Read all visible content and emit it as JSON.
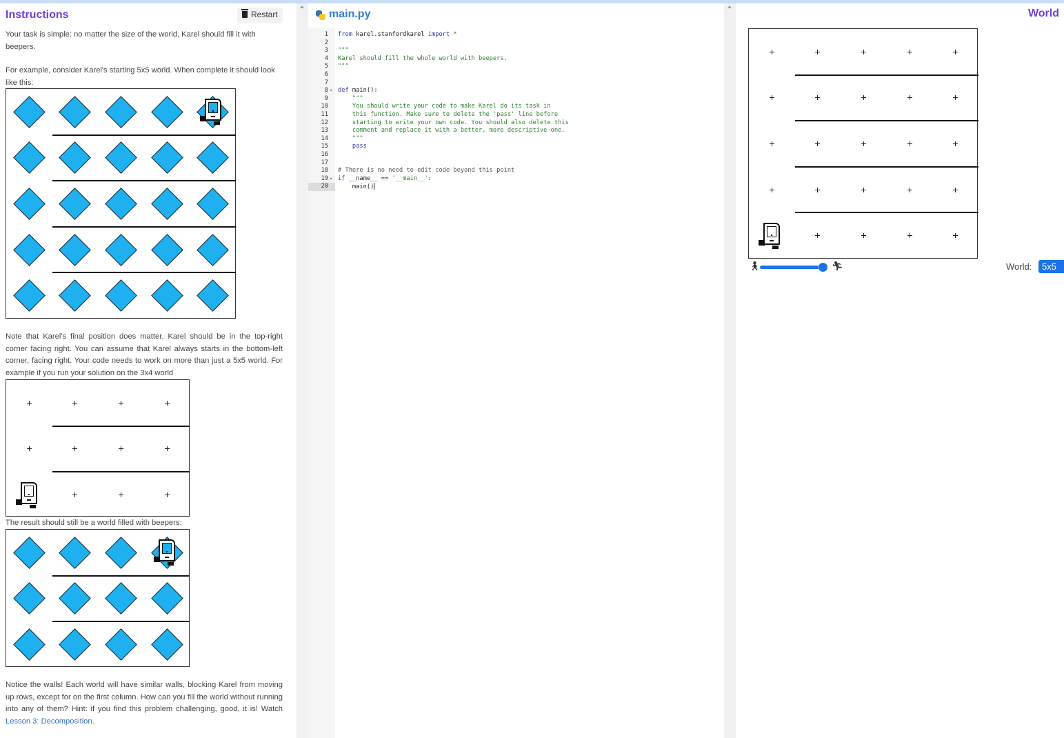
{
  "instructions": {
    "title": "Instructions",
    "restart_label": "Restart",
    "p1": "Your task is simple: no matter the size of the world, Karel should fill it with beepers.",
    "p2": "For example, consider Karel's starting 5x5 world. When complete it should look like this:",
    "p3": "Note that Karel's final position does matter. Karel should be in the top-right corner facing right. You can assume that Karel always starts in the bottom-left corner, facing right. Your code needs to work on more than just a 5x5 world. For example if you run your solution on the 3x4 world",
    "p4": "The result should still be a world filled with beepers:",
    "p5_text": "Notice the walls! Each world will have similar walls, blocking Karel from moving up rows, except for on the first column. How can you fill the world without running into any of them? Hint: if you find this problem challenging, good, it is! Watch ",
    "p5_link": "Lesson 3: Decomposition",
    "p5_end": "."
  },
  "editor": {
    "filename": "main.py",
    "lines": [
      {
        "n": "1",
        "fold": "",
        "html": "<span class=\"kw\">from</span> karel.stanfordkarel <span class=\"kw\">import</span> <span class=\"st\">*</span>"
      },
      {
        "n": "2",
        "fold": "",
        "html": ""
      },
      {
        "n": "3",
        "fold": "",
        "html": "<span class=\"st\">\"\"\"</span>"
      },
      {
        "n": "4",
        "fold": "",
        "html": "<span class=\"st\">Karel should fill the whole world with beepers.</span>"
      },
      {
        "n": "5",
        "fold": "",
        "html": "<span class=\"st\">\"\"\"</span>"
      },
      {
        "n": "6",
        "fold": "",
        "html": ""
      },
      {
        "n": "7",
        "fold": "",
        "html": ""
      },
      {
        "n": "8",
        "fold": "▾",
        "html": "<span class=\"kw\">def</span> main():"
      },
      {
        "n": "9",
        "fold": "",
        "html": "    <span class=\"st\">\"\"\"</span>"
      },
      {
        "n": "10",
        "fold": "",
        "html": "    <span class=\"st\">You should write your code to make Karel do its task in</span>"
      },
      {
        "n": "11",
        "fold": "",
        "html": "    <span class=\"st\">this function. Make sure to delete the 'pass' line before</span>"
      },
      {
        "n": "12",
        "fold": "",
        "html": "    <span class=\"st\">starting to write your own code. You should also delete this</span>"
      },
      {
        "n": "13",
        "fold": "",
        "html": "    <span class=\"st\">comment and replace it with a better, more descriptive one.</span>"
      },
      {
        "n": "14",
        "fold": "",
        "html": "    <span class=\"st\">\"\"\"</span>"
      },
      {
        "n": "15",
        "fold": "",
        "html": "    <span class=\"kw\">pass</span>"
      },
      {
        "n": "16",
        "fold": "",
        "html": ""
      },
      {
        "n": "17",
        "fold": "",
        "html": ""
      },
      {
        "n": "18",
        "fold": "",
        "html": "<span class=\"cm\"># There is no need to edit code beyond this point</span>"
      },
      {
        "n": "19",
        "fold": "▾",
        "html": "<span class=\"kw\">if</span> __name__ == <span class=\"st\">'__main__'</span>:"
      },
      {
        "n": "20",
        "fold": "",
        "html": "    main()<span class=\"cursor\"></span>"
      }
    ]
  },
  "world": {
    "title": "World",
    "world_label": "World:",
    "world_value": "5x5",
    "speed_fraction": 0.92
  },
  "colors": {
    "accent_purple": "#6e3fd4",
    "accent_blue": "#1a73e8",
    "beeper": "#1fb0ef"
  },
  "icons": [
    "trash-icon",
    "python-file-icon",
    "karel-robot-icon",
    "slow-walker-icon",
    "fast-runner-icon",
    "chevron-down-icon"
  ]
}
